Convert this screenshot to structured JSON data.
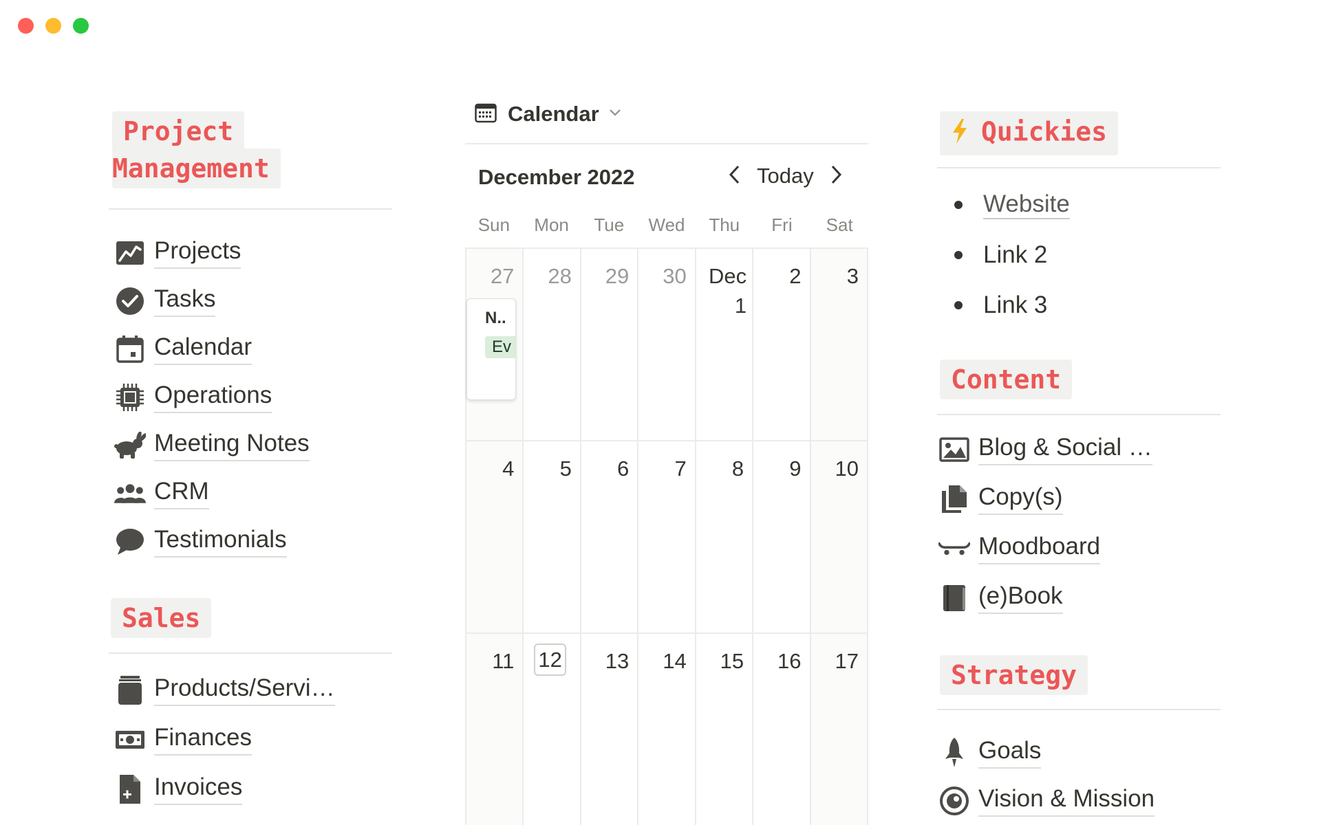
{
  "window": {
    "controls": [
      "close",
      "minimize",
      "zoom"
    ]
  },
  "left": {
    "project_management": {
      "heading_line1": "Project",
      "heading_line2": "Management",
      "items": [
        {
          "label": "Projects",
          "icon": "trend-chart-icon"
        },
        {
          "label": "Tasks",
          "icon": "checkmark-circle-icon"
        },
        {
          "label": "Calendar",
          "icon": "calendar-icon"
        },
        {
          "label": "Operations",
          "icon": "cpu-chip-icon"
        },
        {
          "label": "Meeting Notes",
          "icon": "rabbit-icon"
        },
        {
          "label": "CRM",
          "icon": "people-group-icon"
        },
        {
          "label": "Testimonials",
          "icon": "speech-bubble-icon"
        }
      ]
    },
    "sales": {
      "heading": "Sales",
      "items": [
        {
          "label": "Products/Servi…",
          "icon": "jar-icon"
        },
        {
          "label": "Finances",
          "icon": "banknote-icon"
        },
        {
          "label": "Invoices",
          "icon": "document-plus-icon"
        }
      ]
    }
  },
  "calendar": {
    "view_label": "Calendar",
    "month_label": "December 2022",
    "today_label": "Today",
    "weekdays": [
      "Sun",
      "Mon",
      "Tue",
      "Wed",
      "Thu",
      "Fri",
      "Sat"
    ],
    "weeks": [
      [
        "27",
        "28",
        "29",
        "30",
        "Dec 1",
        "2",
        "3"
      ],
      [
        "4",
        "5",
        "6",
        "7",
        "8",
        "9",
        "10"
      ],
      [
        "11",
        "12",
        "13",
        "14",
        "15",
        "16",
        "17"
      ]
    ],
    "today_date": "12",
    "event": {
      "title": "N..",
      "tag": "Ev"
    }
  },
  "right": {
    "quickies": {
      "heading": "Quickies",
      "items": [
        "Website",
        "Link 2",
        "Link 3"
      ]
    },
    "content": {
      "heading": "Content",
      "items": [
        {
          "label": "Blog & Social …",
          "icon": "image-icon"
        },
        {
          "label": "Copy(s)",
          "icon": "copies-icon"
        },
        {
          "label": "Moodboard",
          "icon": "skateboard-icon"
        },
        {
          "label": "(e)Book",
          "icon": "book-icon"
        }
      ]
    },
    "strategy": {
      "heading": "Strategy",
      "items": [
        {
          "label": "Goals",
          "icon": "rocket-icon"
        },
        {
          "label": "Vision & Mission",
          "icon": "target-icon"
        }
      ]
    }
  },
  "colors": {
    "heading_red": "#eb5757",
    "heading_bg": "#f1f1ef",
    "event_tag_bg": "#dbeddb"
  }
}
